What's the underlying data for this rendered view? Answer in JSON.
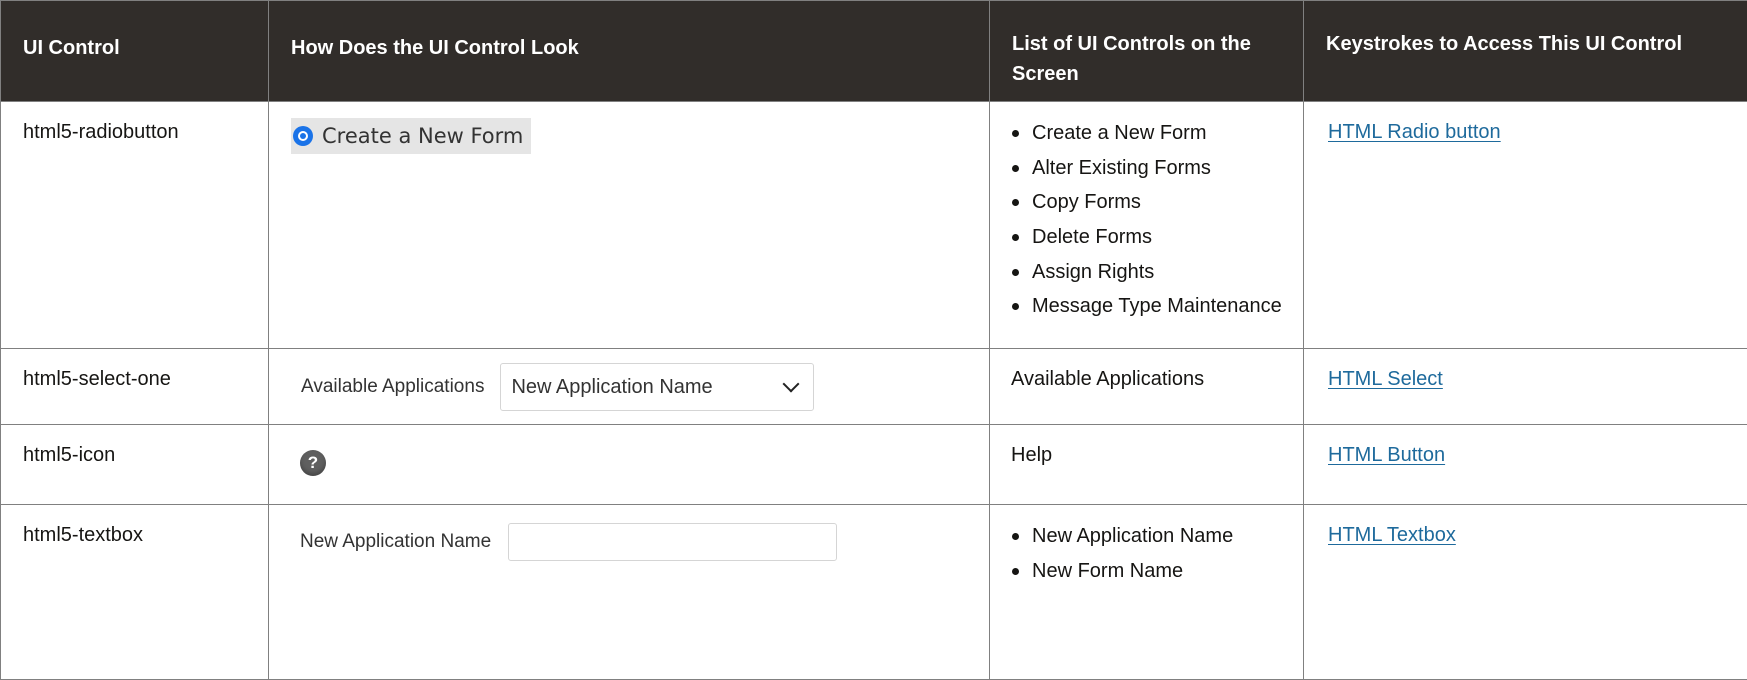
{
  "header": {
    "col1": "UI Control",
    "col2": "How Does the UI Control Look",
    "col3": "List of UI Controls on the Screen",
    "col4": "Keystrokes to Access This UI Control"
  },
  "rows": [
    {
      "control": "html5-radiobutton",
      "look": {
        "radio_label": "Create a New Form",
        "radio_color": "#1a73e8"
      },
      "list": [
        "Create a New Form",
        "Alter Existing Forms",
        "Copy Forms",
        "Delete Forms",
        "Assign Rights",
        "Message Type Maintenance"
      ],
      "link": "HTML Radio button"
    },
    {
      "control": "html5-select-one",
      "look": {
        "label": "Available Applications",
        "selected_value": "New Application Name",
        "icon": "chevron-down-icon"
      },
      "list_text": "Available Applications",
      "link": "HTML Select"
    },
    {
      "control": "html5-icon",
      "look": {
        "icon": "help-icon",
        "glyph": "?"
      },
      "list_text": "Help",
      "link": "HTML Button"
    },
    {
      "control": "html5-textbox",
      "look": {
        "label": "New Application Name",
        "value": ""
      },
      "list": [
        "New Application Name",
        "New Form Name"
      ],
      "link": "HTML Textbox"
    }
  ],
  "colors": {
    "header_bg": "#312d2a",
    "header_text": "#ffffff",
    "link": "#1e6a9c",
    "border": "#808080"
  }
}
